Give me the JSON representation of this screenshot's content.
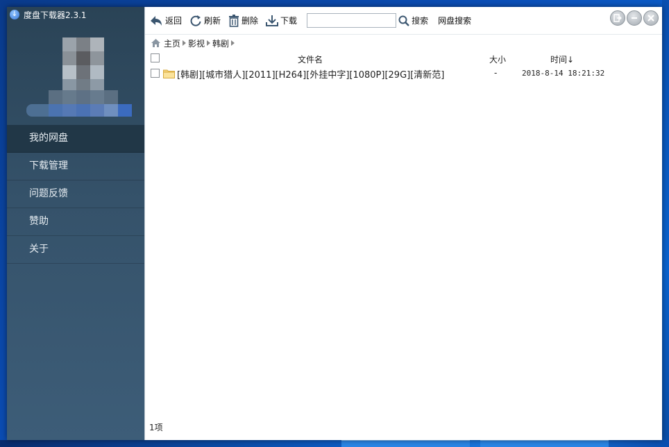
{
  "window": {
    "title": "度盘下载器2.3.1"
  },
  "sidebar": {
    "items": [
      {
        "label": "我的网盘",
        "active": true
      },
      {
        "label": "下载管理",
        "active": false
      },
      {
        "label": "问题反馈",
        "active": false
      },
      {
        "label": "赞助",
        "active": false
      },
      {
        "label": "关于",
        "active": false
      }
    ]
  },
  "toolbar": {
    "back_label": "返回",
    "refresh_label": "刷新",
    "delete_label": "删除",
    "download_label": "下载",
    "search_value": "",
    "search_label": "搜索",
    "netdisk_search_label": "网盘搜索"
  },
  "breadcrumb": [
    "主页",
    "影视",
    "韩剧"
  ],
  "table": {
    "headers": {
      "name": "文件名",
      "size": "大小",
      "time": "时间↓"
    },
    "rows": [
      {
        "type": "folder",
        "name": "[韩剧][城市猎人][2011][H264][外挂中字][1080P][29G][清新范]",
        "size": "-",
        "time": "2018-8-14 18:21:32"
      }
    ]
  },
  "status": {
    "count_text": "1项"
  },
  "colors": {
    "sidebar_top": "#2a4356",
    "sidebar_active": "#213747",
    "accent": "#3b78d8"
  }
}
